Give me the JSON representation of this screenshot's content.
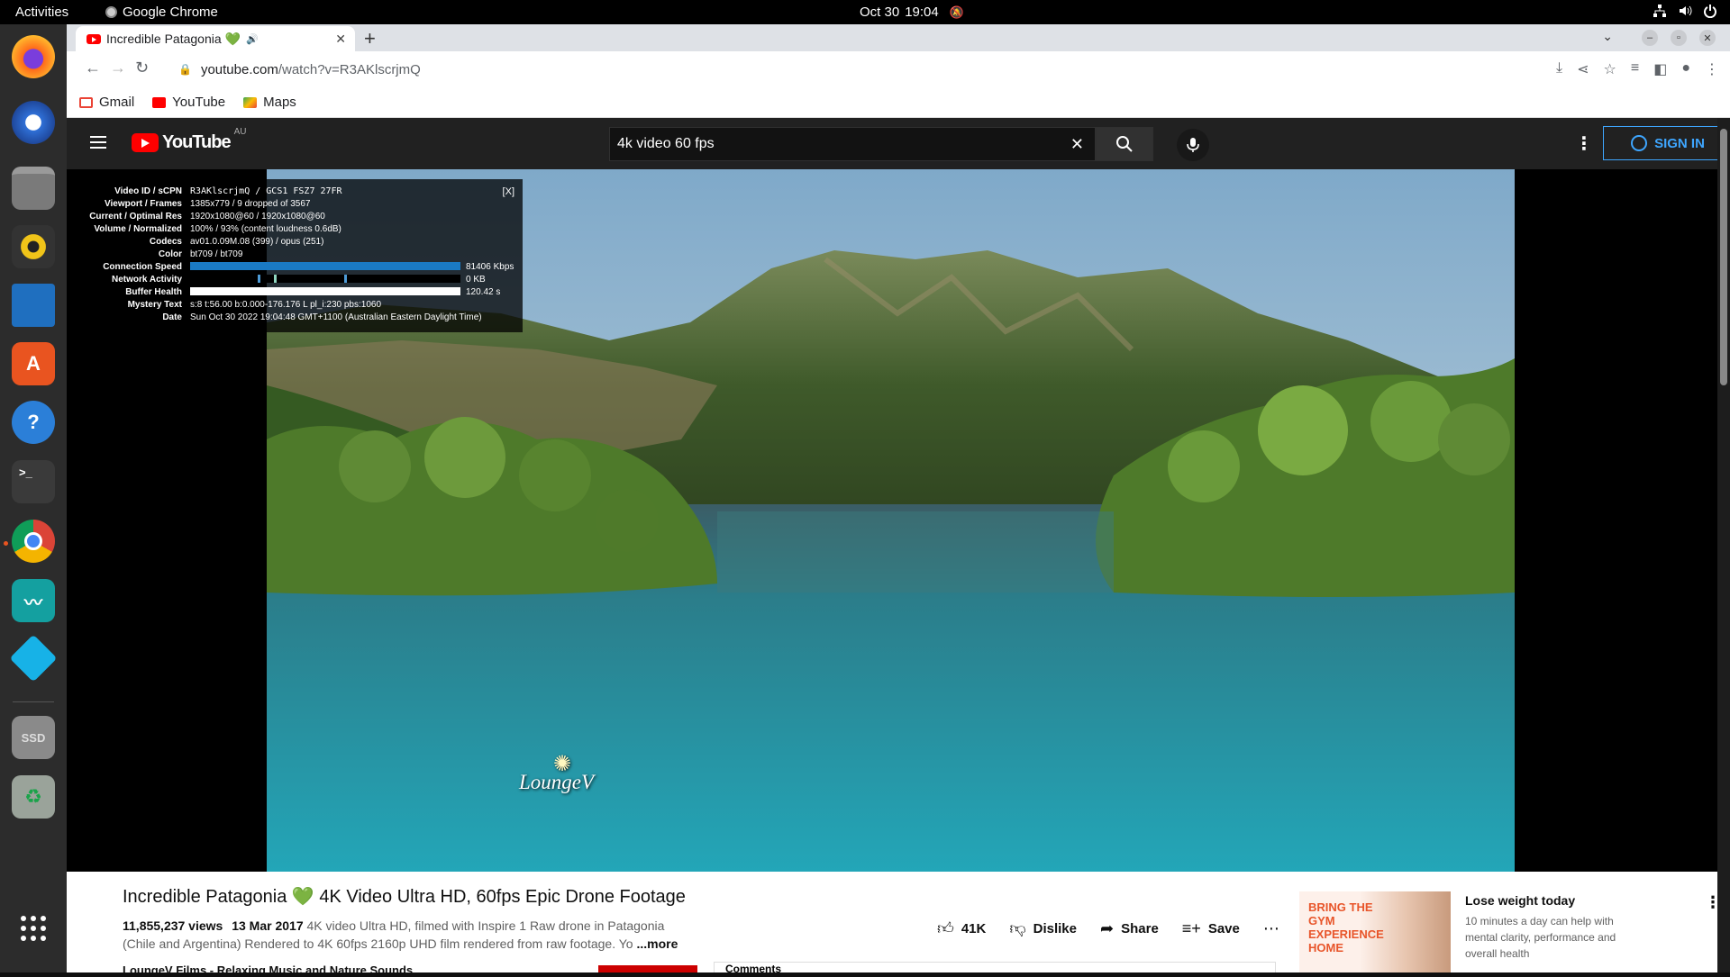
{
  "system": {
    "activities": "Activities",
    "app_name": "Google Chrome",
    "date": "Oct 30",
    "time": "19:04"
  },
  "browser": {
    "tab_title": "Incredible Patagonia 💚",
    "url_host": "youtube.com",
    "url_path": "/watch?v=R3AKlscrjmQ",
    "bookmarks": [
      {
        "label": "Gmail",
        "color": "#ea4335"
      },
      {
        "label": "YouTube",
        "color": "#ff0000"
      },
      {
        "label": "Maps",
        "color": "#34a853"
      }
    ]
  },
  "youtube": {
    "logo_text": "YouTube",
    "region": "AU",
    "search_value": "4k video 60 fps",
    "sign_in_label": "SIGN IN"
  },
  "stats": {
    "close": "[X]",
    "rows": [
      {
        "label": "Video ID / sCPN",
        "value": "R3AKlscrjmQ / GCS1 FSZ7 27FR"
      },
      {
        "label": "Viewport / Frames",
        "value": "1385x779 / 9 dropped of 3567"
      },
      {
        "label": "Current / Optimal Res",
        "value": "1920x1080@60 / 1920x1080@60"
      },
      {
        "label": "Volume / Normalized",
        "value": "100% / 93% (content loudness 0.6dB)"
      },
      {
        "label": "Codecs",
        "value": "av01.0.09M.08 (399) / opus (251)"
      },
      {
        "label": "Color",
        "value": "bt709 / bt709"
      },
      {
        "label": "Connection Speed",
        "value": "81406 Kbps"
      },
      {
        "label": "Network Activity",
        "value": "0 KB"
      },
      {
        "label": "Buffer Health",
        "value": "120.42 s"
      },
      {
        "label": "Mystery Text",
        "value": "s:8 t:56.00 b:0.000-176.176 L pl_i:230 pbs:1060"
      },
      {
        "label": "Date",
        "value": "Sun Oct 30 2022 19:04:48 GMT+1100 (Australian Eastern Daylight Time)"
      }
    ]
  },
  "video": {
    "watermark": "LoungeV",
    "title": "Incredible Patagonia 💚 4K Video Ultra HD, 60fps Epic Drone Footage",
    "views": "11,855,237 views",
    "date": "13 Mar 2017",
    "description": "4K video Ultra HD, filmed with Inspire 1 Raw drone in Patagonia (Chile and Argentina) Rendered to 4K 60fps 2160p UHD film rendered from raw footage.  Yo",
    "more": "...more",
    "likes": "41K",
    "dislike": "Dislike",
    "share": "Share",
    "save": "Save",
    "channel": "LoungeV Films - Relaxing Music and Nature Sounds",
    "comments_label": "Comments"
  },
  "ad": {
    "image_text": "BRING THE GYM EXPERIENCE HOME",
    "title": "Lose weight today",
    "body": "10 minutes a day can help with mental clarity, performance and overall health"
  }
}
